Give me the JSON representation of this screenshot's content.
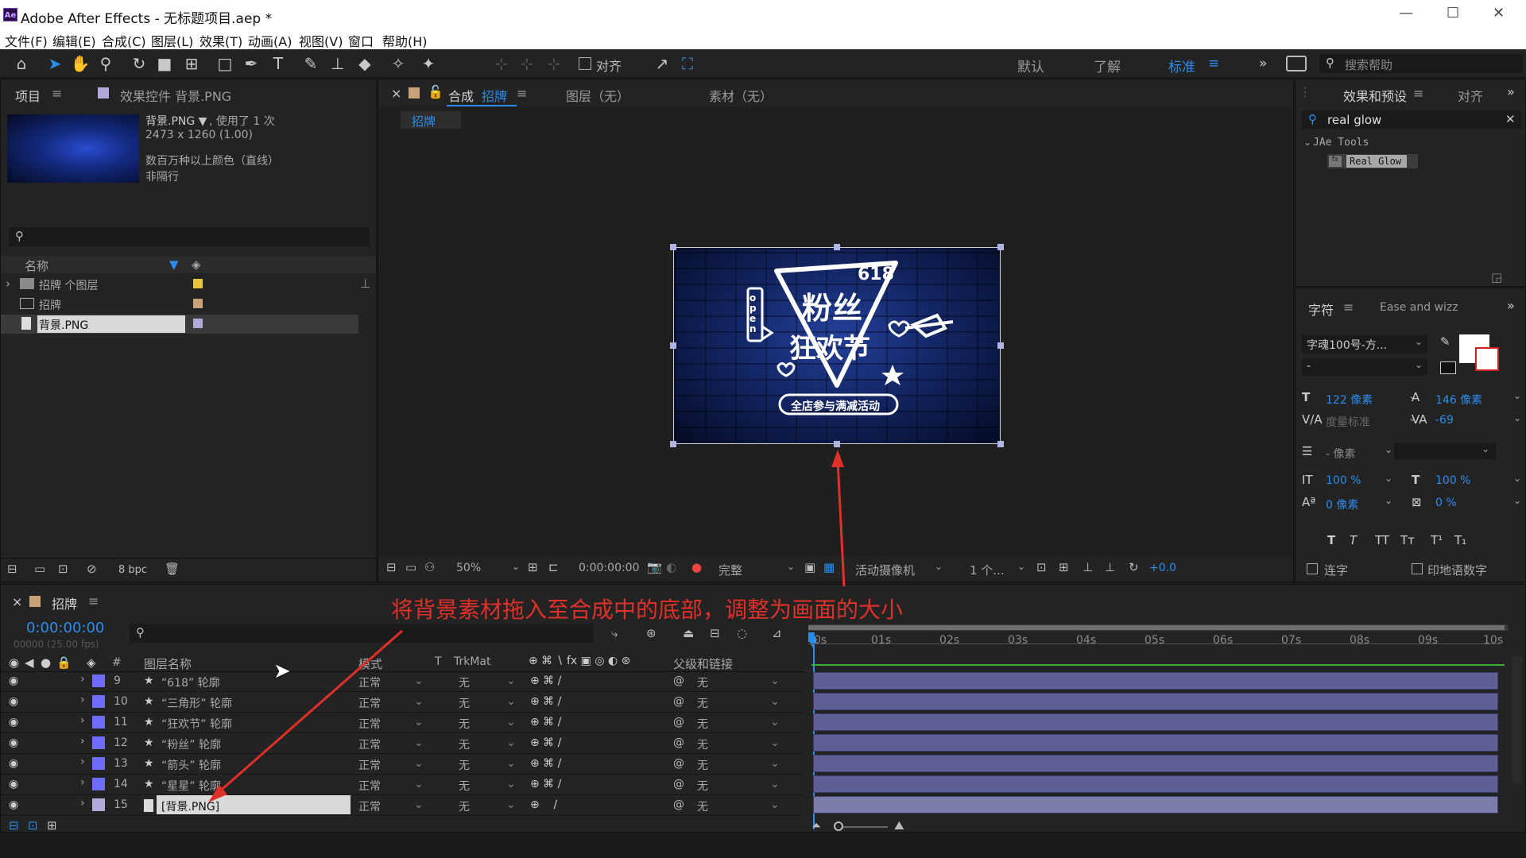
{
  "app": {
    "title": "Adobe After Effects - 无标题项目.aep *",
    "logo": "Ae"
  },
  "menu": [
    "文件(F)",
    "编辑(E)",
    "合成(C)",
    "图层(L)",
    "效果(T)",
    "动画(A)",
    "视图(V)",
    "窗口",
    "帮助(H)"
  ],
  "toolbar": {
    "align_label": "对齐",
    "workspaces": [
      "默认",
      "了解",
      "标准"
    ],
    "search_help": "搜索帮助"
  },
  "project_panel": {
    "tab_project": "项目",
    "tab_effect_controls": "效果控件 背景.PNG",
    "thumb_name": "背景.PNG ▼",
    "thumb_used": ", 使用了 1 次",
    "thumb_size": "2473 x 1260 (1.00)",
    "thumb_colors": "数百万种以上颜色（直线）",
    "thumb_interlace": "非隔行",
    "col_name": "名称",
    "items": [
      {
        "name": "招牌 个图层",
        "type": "folder",
        "color": "#e6c63a"
      },
      {
        "name": "招牌",
        "type": "comp",
        "color": "#c9a27a"
      },
      {
        "name": "背景.PNG",
        "type": "footage",
        "color": "#b4a8d8"
      }
    ],
    "bpc": "8 bpc"
  },
  "comp_panel": {
    "tab_comp": "合成",
    "comp_name": "招牌",
    "tab_layer": "图层（无）",
    "tab_footage": "素材（无）",
    "breadcrumb": "招牌",
    "zoom": "50%",
    "timecode": "0:00:00:00",
    "quality": "完整",
    "camera": "活动摄像机",
    "views": "1 个...",
    "exposure": "+0.0"
  },
  "artwork": {
    "num": "618",
    "line1": "粉丝",
    "line2": "狂欢节",
    "banner": "全店参与满减活动",
    "open": "open"
  },
  "effects_panel": {
    "tab": "效果和预设",
    "tab2": "对齐",
    "search": "real glow",
    "group": "JAe Tools",
    "effect": "Real Glow"
  },
  "char_panel": {
    "tab": "字符",
    "tab2": "Ease and wizz",
    "font": "字魂100号-方...",
    "style": "-",
    "size": "122 像素",
    "leading": "146 像素",
    "kerning": "度量标准",
    "tracking": "-69",
    "stroke": "- 像素",
    "vscale": "100 %",
    "hscale": "100 %",
    "baseline": "0 像素",
    "tsume": "0 %",
    "ligatures": "连字",
    "hindi": "印地语数字"
  },
  "timeline": {
    "tab": "招牌",
    "timecode": "0:00:00:00",
    "frames": "00000 (25.00 fps)",
    "headers": {
      "num": "#",
      "name": "图层名称",
      "mode": "模式",
      "t": "T",
      "trkmat": "TrkMat",
      "parent": "父级和链接"
    },
    "ticks": [
      "0s",
      "01s",
      "02s",
      "03s",
      "04s",
      "05s",
      "06s",
      "07s",
      "08s",
      "09s",
      "10s"
    ],
    "layers": [
      {
        "num": "9",
        "name": "“618” 轮廓",
        "mode": "正常",
        "trk": "无",
        "parent": "无"
      },
      {
        "num": "10",
        "name": "“三角形” 轮廓",
        "mode": "正常",
        "trk": "无",
        "parent": "无"
      },
      {
        "num": "11",
        "name": "“狂欢节” 轮廓",
        "mode": "正常",
        "trk": "无",
        "parent": "无"
      },
      {
        "num": "12",
        "name": "“粉丝” 轮廓",
        "mode": "正常",
        "trk": "无",
        "parent": "无"
      },
      {
        "num": "13",
        "name": "“箭头” 轮廓",
        "mode": "正常",
        "trk": "无",
        "parent": "无"
      },
      {
        "num": "14",
        "name": "“星星” 轮廓",
        "mode": "正常",
        "trk": "无",
        "parent": "无"
      },
      {
        "num": "15",
        "name": "[背景.PNG]",
        "mode": "正常",
        "trk": "无",
        "parent": "无"
      }
    ]
  },
  "annotation": "将背景素材拖入至合成中的底部，调整为画面的大小"
}
